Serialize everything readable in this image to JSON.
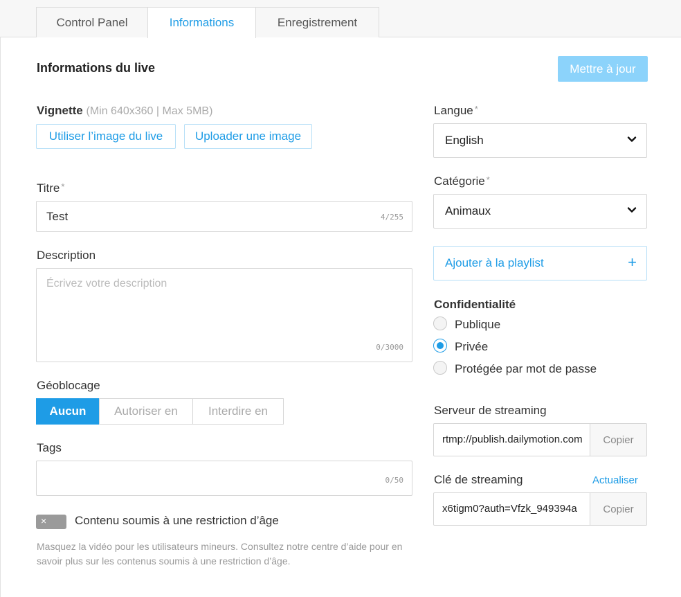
{
  "tabs": [
    {
      "label": "Control Panel"
    },
    {
      "label": "Informations"
    },
    {
      "label": "Enregistrement"
    }
  ],
  "header": {
    "title": "Informations du live",
    "update_button": "Mettre à jour"
  },
  "thumbnail": {
    "label": "Vignette",
    "hint": "(Min 640x360 | Max 5MB)",
    "use_live_image": "Utiliser l’image du live",
    "upload_image": "Uploader une image"
  },
  "title_field": {
    "label": "Titre",
    "required": "*",
    "value": "Test",
    "counter": "4/255"
  },
  "description_field": {
    "label": "Description",
    "placeholder": "Écrivez votre description",
    "counter": "0/3000"
  },
  "geoblocking": {
    "label": "Géoblocage",
    "options": [
      "Aucun",
      "Autoriser en",
      "Interdire en"
    ]
  },
  "tags": {
    "label": "Tags",
    "counter": "0/50"
  },
  "age_restriction": {
    "toggle_glyph": "×",
    "label": "Contenu soumis à une restriction d’âge",
    "help": "Masquez la vidéo pour les utilisateurs mineurs. Consultez notre centre d’aide pour en savoir plus sur les contenus soumis à une restriction d’âge."
  },
  "language": {
    "label": "Langue",
    "required": "*",
    "value": "English"
  },
  "category": {
    "label": "Catégorie",
    "required": "*",
    "value": "Animaux"
  },
  "playlist": {
    "label": "Ajouter à la playlist",
    "icon": "+"
  },
  "privacy": {
    "label": "Confidentialité",
    "options": [
      "Publique",
      "Privée",
      "Protégée par mot de passe"
    ]
  },
  "streaming_server": {
    "label": "Serveur de streaming",
    "value": "rtmp://publish.dailymotion.com",
    "copy": "Copier"
  },
  "streaming_key": {
    "label": "Clé de streaming",
    "refresh": "Actualiser",
    "value": "x6tigm0?auth=Vfzk_949394a",
    "copy": "Copier"
  },
  "colors": {
    "accent": "#1e9ce6",
    "accent_light": "#8cd3fb"
  }
}
